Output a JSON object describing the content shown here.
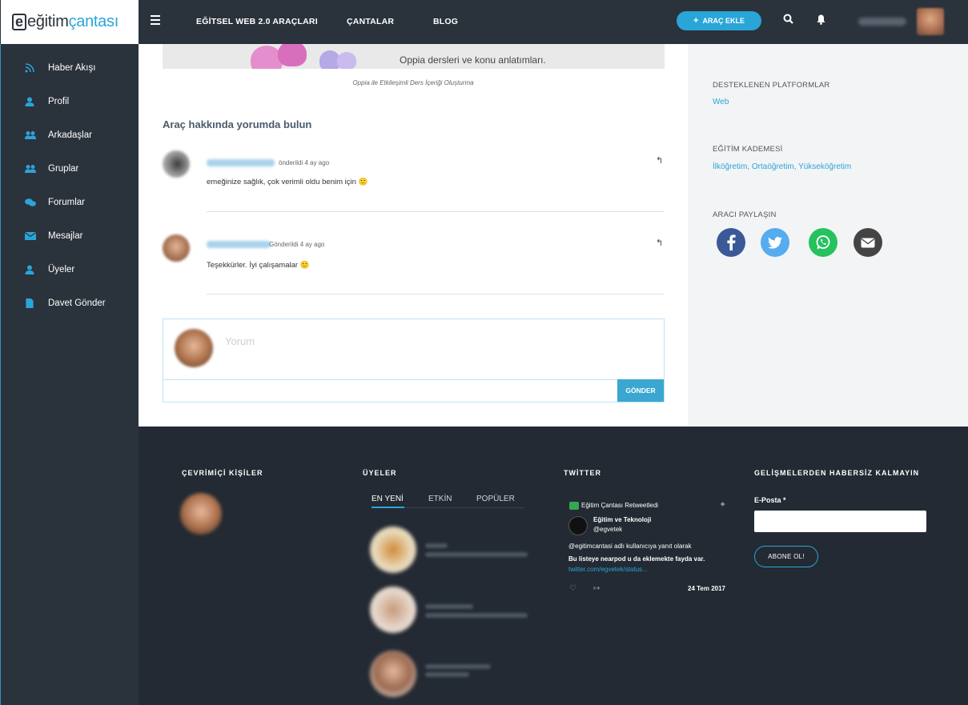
{
  "header": {
    "logo_part1": "eğitim",
    "logo_part2": "çantası",
    "nav": [
      "EĞİTSEL WEB 2.0 ARAÇLARI",
      "ÇANTALAR",
      "BLOG"
    ],
    "add_button": "ARAÇ EKLE"
  },
  "sidebar": {
    "items": [
      {
        "label": "Haber Akışı",
        "icon": "rss-icon"
      },
      {
        "label": "Profil",
        "icon": "user-icon"
      },
      {
        "label": "Arkadaşlar",
        "icon": "friends-icon"
      },
      {
        "label": "Gruplar",
        "icon": "groups-icon"
      },
      {
        "label": "Forumlar",
        "icon": "forum-icon"
      },
      {
        "label": "Mesajlar",
        "icon": "mail-icon"
      },
      {
        "label": "Üyeler",
        "icon": "members-icon"
      },
      {
        "label": "Davet Gönder",
        "icon": "document-icon"
      }
    ]
  },
  "main": {
    "hero_text": "Oppia dersleri ve konu anlatımları.",
    "caption": "Oppia ile Etkileşimli Ders İçeriği Oluşturma",
    "comments_title": "Araç hakkında yorumda bulun",
    "comments": [
      {
        "meta": "önderildi 4 ay ago",
        "text": "emeğinize sağlık, çok verimli oldu benim için 🙂"
      },
      {
        "meta": "Gönderildi 4 ay ago",
        "text": "Teşekkürler. İyi çalışamalar 🙂"
      }
    ],
    "comment_placeholder": "Yorum",
    "send_button": "GÖNDER"
  },
  "right_panel": {
    "platforms_title": "DESTEKLENEN PLATFORMLAR",
    "platforms_value": "Web",
    "level_title": "EĞİTİM KADEMESİ",
    "level_value": "İlköğretim, Ortaöğretim, Yükseköğretim",
    "share_title": "ARACI PAYLAŞIN",
    "share": [
      {
        "name": "facebook",
        "glyph": "f",
        "color": "#3b5998"
      },
      {
        "name": "twitter",
        "glyph": "t",
        "color": "#55acee"
      },
      {
        "name": "whatsapp",
        "glyph": "w",
        "color": "#25c25e"
      },
      {
        "name": "email",
        "glyph": "@",
        "color": "#444444"
      }
    ]
  },
  "footer": {
    "online_title": "ÇEVRİMİÇİ KİŞİLER",
    "members_title": "ÜYELER",
    "member_tabs": [
      "EN YENİ",
      "ETKİN",
      "POPÜLER"
    ],
    "twitter_title": "TWİTTER",
    "tweet": {
      "retweet_label": "Eğitim Çantası Retweetledi",
      "author": "Eğitim ve Teknoloji",
      "handle": "@egvetek",
      "reply_line": "@egitimcantasi adlı kullanıcıya yanıt olarak",
      "text": "Bu listeye nearpod u da eklemekte fayda var.",
      "link": "twitter.com/egvetek/status...",
      "date": "24 Tem 2017"
    },
    "newsletter_title": "GELİŞMELERDEN HABERSİZ KALMAYIN",
    "email_label": "E-Posta *",
    "subscribe_button": "ABONE OL!"
  }
}
